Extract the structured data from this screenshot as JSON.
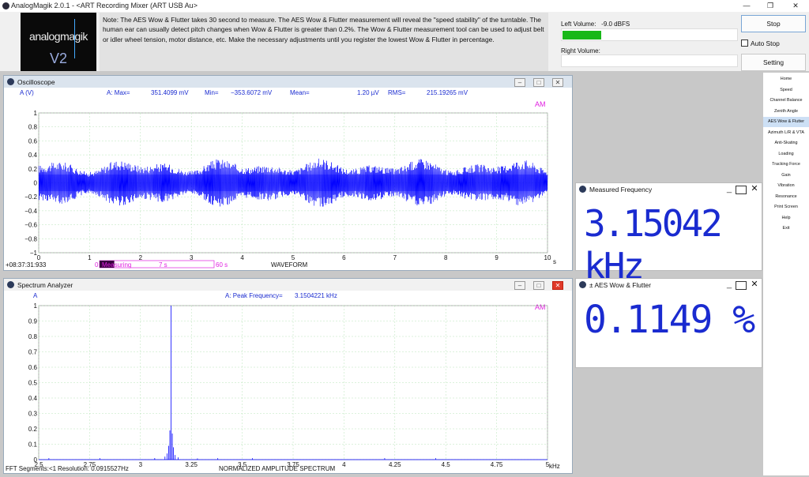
{
  "window": {
    "title": "AnalogMagik 2.0.1   -   <ART Recording Mixer (ART USB Au>"
  },
  "logo": {
    "text": "analogmagik",
    "version": "V2"
  },
  "note": "Note:  The AES Wow & Flutter takes 30 second to measure.  The AES Wow & Flutter measurement will reveal the \"speed stability\" of the turntable.  The human ear can usually detect pitch changes when Wow & Flutter is greater than 0.2%.    The Wow & Flutter measurement tool can be used to adjust belt or idler wheel tension, motor distance, etc.  Make the necessary adjustments until you register the lowest Wow & Flutter in percentage.",
  "volume": {
    "left_label": "Left Volume:",
    "left_value": "-9.0 dBFS",
    "left_level": 0.22,
    "right_label": "Right Volume:"
  },
  "controls": {
    "stop": "Stop",
    "auto_stop": "Auto Stop",
    "setting": "Setting"
  },
  "oscilloscope": {
    "title": "Oscilloscope",
    "ylabel": "A (V)",
    "stats": {
      "max_label": "A: Max=",
      "max": "351.4099 mV",
      "min_label": "Min=",
      "min": "−353.6072 mV",
      "mean_label": "Mean=",
      "mean": "1.20  µV",
      "rms_label": "RMS=",
      "rms": "215.19265 mV"
    },
    "am": "AM",
    "timestamp": "+08:37:31:933",
    "progress": {
      "start": "0",
      "status": "Measuring",
      "elapsed": "7 s",
      "total": "60 s"
    },
    "footer": "WAVEFORM",
    "xunit": "s",
    "chart_data": {
      "type": "line",
      "xlim": [
        0,
        10
      ],
      "ylim": [
        -1,
        1
      ],
      "xticks": [
        "0",
        "1",
        "2",
        "3",
        "4",
        "5",
        "6",
        "7",
        "8",
        "9",
        "10"
      ],
      "yticks": [
        "1",
        "0.8",
        "0.6",
        "0.4",
        "0.2",
        "0",
        "−0.2",
        "−0.4",
        "−0.6",
        "−0.8",
        "−1"
      ],
      "amplitude_peak": 0.3514,
      "amplitude_rms": 0.2152,
      "color": "#0000ff"
    }
  },
  "spectrum": {
    "title": "Spectrum Analyzer",
    "ylabel": "A",
    "peak_label": "A: Peak Frequency=",
    "peak_value": "3.1504221  kHz",
    "am": "AM",
    "fft": "FFT Segments:<1",
    "resolution": "Resolution: 0.0915527Hz",
    "footer": "NORMALIZED AMPLITUDE SPECTRUM",
    "xunit": "kHz",
    "chart_data": {
      "type": "line",
      "xlim": [
        2.5,
        5
      ],
      "ylim": [
        0,
        1
      ],
      "xticks": [
        "2.5",
        "2.75",
        "3",
        "3.25",
        "3.5",
        "3.75",
        "4",
        "4.25",
        "4.5",
        "4.75",
        "5"
      ],
      "yticks": [
        "1",
        "0.9",
        "0.8",
        "0.7",
        "0.6",
        "0.5",
        "0.4",
        "0.3",
        "0.2",
        "0.1",
        "0"
      ],
      "peak_frequency": 3.1504,
      "peak_amplitude": 1.0,
      "color": "#0000ff"
    }
  },
  "freq_panel": {
    "title": "Measured Frequency",
    "value": "3.15042 kHz"
  },
  "wf_panel": {
    "title": "± AES Wow & Flutter",
    "value": "0.1149 %"
  },
  "sidebar": {
    "items": [
      {
        "label": "Home"
      },
      {
        "label": "Speed"
      },
      {
        "label": "Channel Balance"
      },
      {
        "label": "Zenith Angle"
      },
      {
        "label": "AES Wow & Flutter"
      },
      {
        "label": "Azimuth L/R & VTA"
      },
      {
        "label": "Anti-Skating"
      },
      {
        "label": "Loading"
      },
      {
        "label": "Tracking Force"
      },
      {
        "label": "Gain"
      },
      {
        "label": "Vibration"
      },
      {
        "label": "Resonance"
      },
      {
        "label": "Print Screen"
      },
      {
        "label": "Help"
      },
      {
        "label": "Exit"
      }
    ],
    "active_index": 4
  }
}
